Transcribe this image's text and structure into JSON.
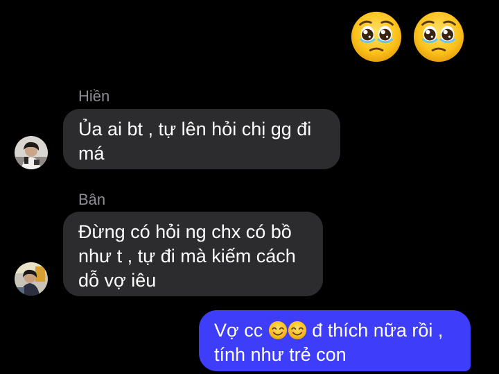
{
  "top_reactions": [
    {
      "icon": "pleading-face-icon"
    },
    {
      "icon": "pleading-face-icon"
    }
  ],
  "messages": [
    {
      "sender": "Hiền",
      "direction": "incoming",
      "lines": [
        "Ủa ai bt , tự lên hỏi chị gg đi",
        "má"
      ],
      "avatar": "avatar-hien"
    },
    {
      "sender": "Bân",
      "direction": "incoming",
      "lines": [
        "Đừng có hỏi ng chx có bồ",
        "như t , tự đi mà kiếm cách",
        "dỗ vợ iêu"
      ],
      "avatar": "avatar-ban"
    },
    {
      "direction": "outgoing",
      "line1_prefix": "Vợ cc",
      "line1_emojis": [
        "smiling-face-icon",
        "smiling-face-icon"
      ],
      "line1_suffix": "đ thích nữa rồi ,",
      "line2": "tính như trẻ con"
    }
  ],
  "colors": {
    "background": "#000000",
    "incoming_bubble": "#2c2c2e",
    "outgoing_bubble": "#3d3dfa",
    "sender_name": "#8e8e93",
    "text": "#ffffff"
  }
}
